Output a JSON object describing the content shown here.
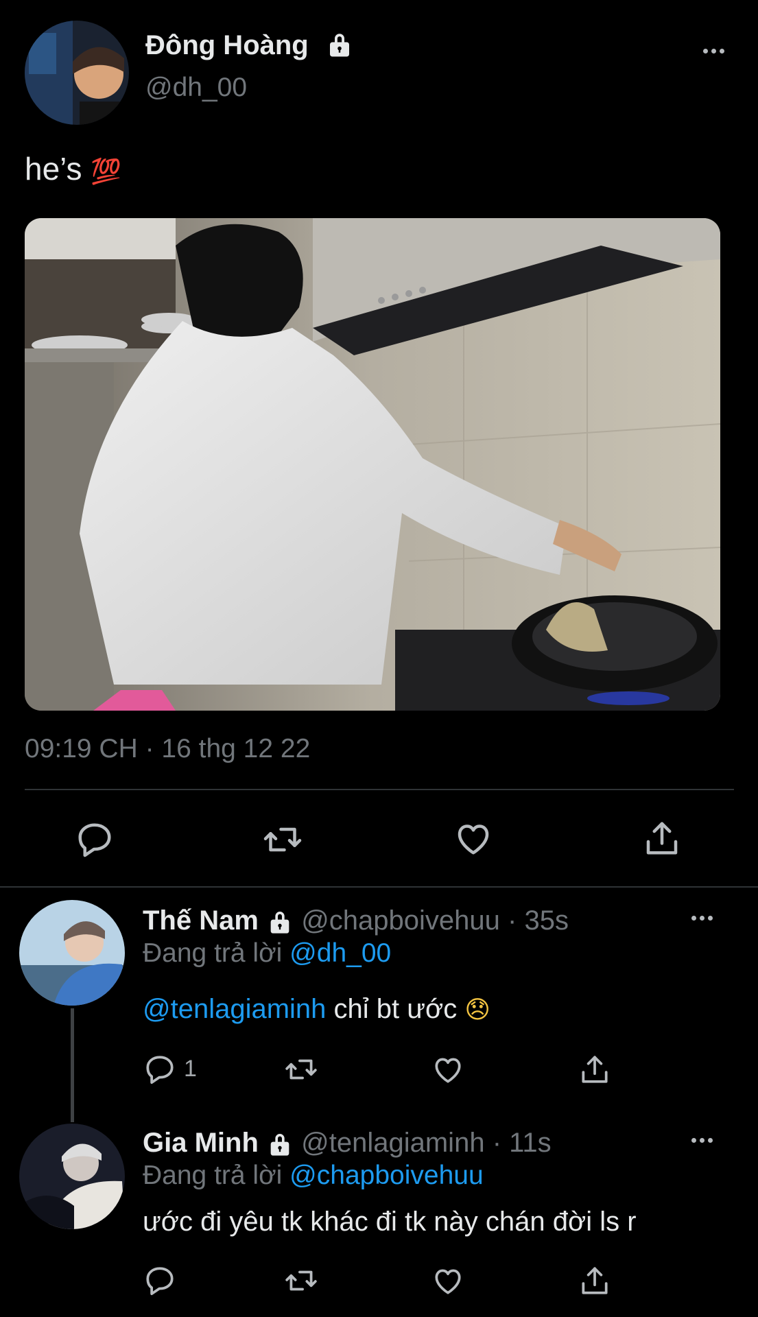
{
  "main_tweet": {
    "author_name": "Đông Hoàng",
    "author_handle": "@dh_00",
    "text": "he’s",
    "emoji": "💯",
    "timestamp": "09:19 CH · 16 thg 12 22"
  },
  "replies": [
    {
      "author_name": "Thế Nam",
      "author_handle": "@chapboivehuu",
      "time": "· 35s",
      "replying_prefix": "Đang trả lời",
      "replying_to": "@dh_00",
      "mention": "@tenlagiaminh",
      "text": " chỉ bt ước",
      "emoji": "😞",
      "reply_count": "1"
    },
    {
      "author_name": "Gia Minh",
      "author_handle": "@tenlagiaminh",
      "time": "· 11s",
      "replying_prefix": "Đang trả lời",
      "replying_to": "@chapboivehuu",
      "text": "ước đi yêu tk khác đi tk này chán đời ls r"
    }
  ],
  "icons": {
    "lock": "lock-icon",
    "more": "more-icon",
    "reply": "reply-icon",
    "retweet": "retweet-icon",
    "like": "like-icon",
    "share": "share-icon"
  },
  "colors": {
    "background": "#000000",
    "text": "#e7e9ea",
    "muted": "#71767b",
    "link": "#1d9bf0",
    "divider": "#2f3336"
  }
}
